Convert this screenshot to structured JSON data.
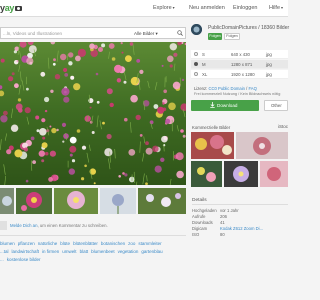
{
  "header": {
    "logo_text": "y",
    "nav": {
      "explore": "Explore",
      "register": "Neu anmelden",
      "login": "Einloggen",
      "help": "Hilfe"
    }
  },
  "search": {
    "placeholder": "...ln, Videos und Illustrationen",
    "scope": "Alle Bilder"
  },
  "comment": {
    "link": "Melde Dich an",
    "text": ", um einen Kommentar zu schreiben."
  },
  "tags": {
    "line1": [
      "blumen",
      "pflanzen",
      "natürliche",
      "blüte",
      "blütenblätter",
      "botanischen",
      "zoo",
      "stammleiter"
    ],
    "line2": [
      "...tal",
      "landwirtschaft",
      "in firmen",
      "umwelt",
      "blatt",
      "blumenbeet",
      "vegetation",
      "gartenblau"
    ],
    "line3": [
      "...",
      "kostenlose bilder"
    ]
  },
  "author": {
    "name": "PublicDomainPictures / 18360 Bilder",
    "follow_label": "Folgen",
    "follow_label2": "Folgen"
  },
  "sizes": [
    {
      "label": "S",
      "dims": "640 x 430",
      "ext": "jpg",
      "selected": false
    },
    {
      "label": "M",
      "dims": "1280 x 871",
      "ext": "jpg",
      "selected": true
    },
    {
      "label": "XL",
      "dims": "1920 x 1280",
      "ext": "jpg",
      "selected": false
    }
  ],
  "license": {
    "prefix": "Lizenz: ",
    "link": "CC0 Public Domain",
    "sep": " / ",
    "faq": "FAQ",
    "line2": "Frei kommerziell Nutzung / Kein Bildnachweis nötig"
  },
  "download": {
    "label": "Download",
    "other_label": "Other"
  },
  "related": {
    "title": "Kommerzielle Bilder",
    "side": "iStoc"
  },
  "details": {
    "title": "Details",
    "rows": [
      {
        "k": "Hochgeladen",
        "v": "vor 1 Jahr",
        "link": false
      },
      {
        "k": "Aufrufe",
        "v": "206",
        "link": false
      },
      {
        "k": "Downloads",
        "v": "41",
        "link": false
      },
      {
        "k": "Digicam",
        "v": "Kodak Z612 Zoom Di...",
        "link": true
      },
      {
        "k": "ISO",
        "v": "80",
        "link": false
      }
    ]
  }
}
